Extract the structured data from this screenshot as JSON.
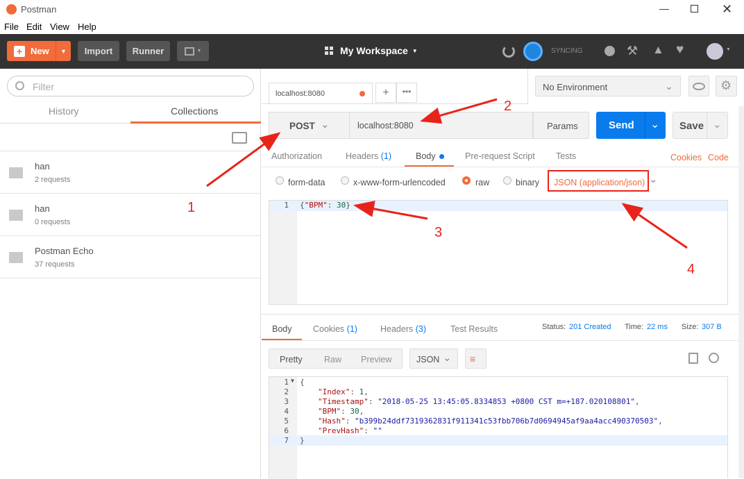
{
  "window": {
    "title": "Postman"
  },
  "menu": [
    "File",
    "Edit",
    "View",
    "Help"
  ],
  "header": {
    "new_label": "New",
    "import_label": "Import",
    "runner_label": "Runner",
    "workspace_label": "My Workspace",
    "sync_label": "SYNCING"
  },
  "sidebar": {
    "filter_placeholder": "Filter",
    "tabs": [
      "History",
      "Collections"
    ],
    "collections": [
      {
        "name": "han",
        "count": "2 requests"
      },
      {
        "name": "han",
        "count": "0 requests"
      },
      {
        "name": "Postman Echo",
        "count": "37 requests"
      }
    ]
  },
  "request_tab": {
    "label": "localhost:8080"
  },
  "environment": {
    "label": "No Environment"
  },
  "request": {
    "method": "POST",
    "url": "localhost:8080",
    "params_label": "Params",
    "send_label": "Send",
    "save_label": "Save"
  },
  "req_tabs": {
    "authorization": "Authorization",
    "headers": "Headers",
    "headers_count": "(1)",
    "body": "Body",
    "prerequest": "Pre-request Script",
    "tests": "Tests",
    "cookies": "Cookies",
    "code": "Code"
  },
  "body_modes": {
    "form_data": "form-data",
    "urlencoded": "x-www-form-urlencoded",
    "raw": "raw",
    "binary": "binary",
    "content_type": "JSON (application/json)"
  },
  "editor": {
    "line_no": "1",
    "text_open": "{",
    "key": "\"BPM\"",
    "colon": ": ",
    "value": "30",
    "text_close": "}"
  },
  "response": {
    "tabs": {
      "body": "Body",
      "cookies": "Cookies",
      "cookies_count": "(1)",
      "headers": "Headers",
      "headers_count": "(3)",
      "test_results": "Test Results"
    },
    "status_label": "Status:",
    "status_value": "201 Created",
    "time_label": "Time:",
    "time_value": "22 ms",
    "size_label": "Size:",
    "size_value": "307 B",
    "view_modes": [
      "Pretty",
      "Raw",
      "Preview"
    ],
    "format": "JSON",
    "line_numbers": [
      "1",
      "2",
      "3",
      "4",
      "5",
      "6",
      "7"
    ],
    "lines": [
      {
        "k": "",
        "v": "{"
      },
      {
        "k": "\"Index\"",
        "v": "1"
      },
      {
        "k": "\"Timestamp\"",
        "v": "\"2018-05-25 13:45:05.8334853 +0800 CST m=+187.020108801\""
      },
      {
        "k": "\"BPM\"",
        "v": "30"
      },
      {
        "k": "\"Hash\"",
        "v": "\"b399b24ddf7319362831f911341c53fbb706b7d0694945af9aa4acc490370503\""
      },
      {
        "k": "\"PrevHash\"",
        "v": "\"\""
      },
      {
        "k": "",
        "v": "}"
      }
    ]
  },
  "annotations": [
    "1",
    "2",
    "3",
    "4"
  ],
  "colors": {
    "accent": "#f26b3a",
    "send": "#097bed",
    "annotation": "#e8231a"
  }
}
